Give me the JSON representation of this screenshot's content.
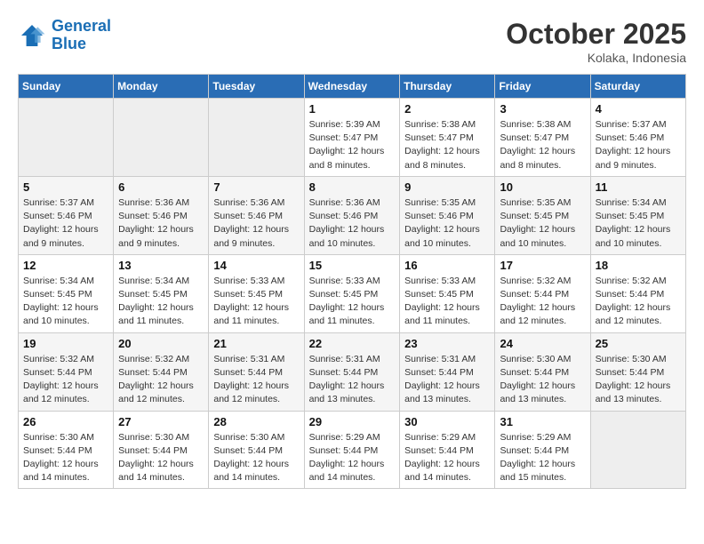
{
  "header": {
    "logo_line1": "General",
    "logo_line2": "Blue",
    "month": "October 2025",
    "location": "Kolaka, Indonesia"
  },
  "weekdays": [
    "Sunday",
    "Monday",
    "Tuesday",
    "Wednesday",
    "Thursday",
    "Friday",
    "Saturday"
  ],
  "weeks": [
    [
      {
        "day": "",
        "info": ""
      },
      {
        "day": "",
        "info": ""
      },
      {
        "day": "",
        "info": ""
      },
      {
        "day": "1",
        "info": "Sunrise: 5:39 AM\nSunset: 5:47 PM\nDaylight: 12 hours\nand 8 minutes."
      },
      {
        "day": "2",
        "info": "Sunrise: 5:38 AM\nSunset: 5:47 PM\nDaylight: 12 hours\nand 8 minutes."
      },
      {
        "day": "3",
        "info": "Sunrise: 5:38 AM\nSunset: 5:47 PM\nDaylight: 12 hours\nand 8 minutes."
      },
      {
        "day": "4",
        "info": "Sunrise: 5:37 AM\nSunset: 5:46 PM\nDaylight: 12 hours\nand 9 minutes."
      }
    ],
    [
      {
        "day": "5",
        "info": "Sunrise: 5:37 AM\nSunset: 5:46 PM\nDaylight: 12 hours\nand 9 minutes."
      },
      {
        "day": "6",
        "info": "Sunrise: 5:36 AM\nSunset: 5:46 PM\nDaylight: 12 hours\nand 9 minutes."
      },
      {
        "day": "7",
        "info": "Sunrise: 5:36 AM\nSunset: 5:46 PM\nDaylight: 12 hours\nand 9 minutes."
      },
      {
        "day": "8",
        "info": "Sunrise: 5:36 AM\nSunset: 5:46 PM\nDaylight: 12 hours\nand 10 minutes."
      },
      {
        "day": "9",
        "info": "Sunrise: 5:35 AM\nSunset: 5:46 PM\nDaylight: 12 hours\nand 10 minutes."
      },
      {
        "day": "10",
        "info": "Sunrise: 5:35 AM\nSunset: 5:45 PM\nDaylight: 12 hours\nand 10 minutes."
      },
      {
        "day": "11",
        "info": "Sunrise: 5:34 AM\nSunset: 5:45 PM\nDaylight: 12 hours\nand 10 minutes."
      }
    ],
    [
      {
        "day": "12",
        "info": "Sunrise: 5:34 AM\nSunset: 5:45 PM\nDaylight: 12 hours\nand 10 minutes."
      },
      {
        "day": "13",
        "info": "Sunrise: 5:34 AM\nSunset: 5:45 PM\nDaylight: 12 hours\nand 11 minutes."
      },
      {
        "day": "14",
        "info": "Sunrise: 5:33 AM\nSunset: 5:45 PM\nDaylight: 12 hours\nand 11 minutes."
      },
      {
        "day": "15",
        "info": "Sunrise: 5:33 AM\nSunset: 5:45 PM\nDaylight: 12 hours\nand 11 minutes."
      },
      {
        "day": "16",
        "info": "Sunrise: 5:33 AM\nSunset: 5:45 PM\nDaylight: 12 hours\nand 11 minutes."
      },
      {
        "day": "17",
        "info": "Sunrise: 5:32 AM\nSunset: 5:44 PM\nDaylight: 12 hours\nand 12 minutes."
      },
      {
        "day": "18",
        "info": "Sunrise: 5:32 AM\nSunset: 5:44 PM\nDaylight: 12 hours\nand 12 minutes."
      }
    ],
    [
      {
        "day": "19",
        "info": "Sunrise: 5:32 AM\nSunset: 5:44 PM\nDaylight: 12 hours\nand 12 minutes."
      },
      {
        "day": "20",
        "info": "Sunrise: 5:32 AM\nSunset: 5:44 PM\nDaylight: 12 hours\nand 12 minutes."
      },
      {
        "day": "21",
        "info": "Sunrise: 5:31 AM\nSunset: 5:44 PM\nDaylight: 12 hours\nand 12 minutes."
      },
      {
        "day": "22",
        "info": "Sunrise: 5:31 AM\nSunset: 5:44 PM\nDaylight: 12 hours\nand 13 minutes."
      },
      {
        "day": "23",
        "info": "Sunrise: 5:31 AM\nSunset: 5:44 PM\nDaylight: 12 hours\nand 13 minutes."
      },
      {
        "day": "24",
        "info": "Sunrise: 5:30 AM\nSunset: 5:44 PM\nDaylight: 12 hours\nand 13 minutes."
      },
      {
        "day": "25",
        "info": "Sunrise: 5:30 AM\nSunset: 5:44 PM\nDaylight: 12 hours\nand 13 minutes."
      }
    ],
    [
      {
        "day": "26",
        "info": "Sunrise: 5:30 AM\nSunset: 5:44 PM\nDaylight: 12 hours\nand 14 minutes."
      },
      {
        "day": "27",
        "info": "Sunrise: 5:30 AM\nSunset: 5:44 PM\nDaylight: 12 hours\nand 14 minutes."
      },
      {
        "day": "28",
        "info": "Sunrise: 5:30 AM\nSunset: 5:44 PM\nDaylight: 12 hours\nand 14 minutes."
      },
      {
        "day": "29",
        "info": "Sunrise: 5:29 AM\nSunset: 5:44 PM\nDaylight: 12 hours\nand 14 minutes."
      },
      {
        "day": "30",
        "info": "Sunrise: 5:29 AM\nSunset: 5:44 PM\nDaylight: 12 hours\nand 14 minutes."
      },
      {
        "day": "31",
        "info": "Sunrise: 5:29 AM\nSunset: 5:44 PM\nDaylight: 12 hours\nand 15 minutes."
      },
      {
        "day": "",
        "info": ""
      }
    ]
  ]
}
